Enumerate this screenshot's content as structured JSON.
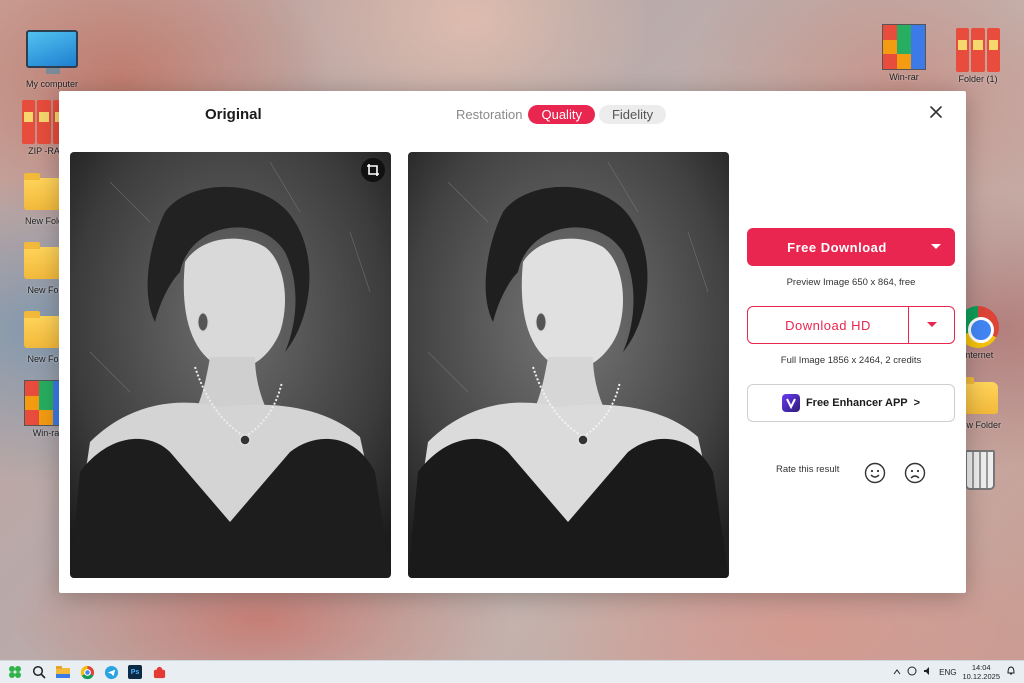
{
  "desktop": {
    "icons": [
      {
        "label": "My computer",
        "icon": "computer-icon"
      },
      {
        "label": "ZIP -RA",
        "icon": "binders-icon"
      },
      {
        "label": "New Fold",
        "icon": "folder-icon"
      },
      {
        "label": "New Fol",
        "icon": "folder-icon"
      },
      {
        "label": "New Fol",
        "icon": "folder-icon"
      },
      {
        "label": "Win-ra",
        "icon": "winrar-icon"
      },
      {
        "label": "Win-rar",
        "icon": "winrar-icon"
      },
      {
        "label": "Folder (1)",
        "icon": "binders-icon"
      },
      {
        "label": "Internet",
        "icon": "chrome-icon"
      },
      {
        "label": "New Folder",
        "icon": "folder-icon"
      },
      {
        "label": "",
        "icon": "recycle-bin-icon"
      }
    ]
  },
  "modal": {
    "title": "Original",
    "tabs": [
      {
        "label": "Restoration",
        "state": "plain"
      },
      {
        "label": "Quality",
        "state": "active"
      },
      {
        "label": "Fidelity",
        "state": "inactive"
      }
    ],
    "free_download": {
      "label": "Free Download",
      "note": "Preview Image 650 x 864, free"
    },
    "download_hd": {
      "label": "Download HD",
      "note": "Full Image 1856 x 2464, 2 credits"
    },
    "enhancer_app": {
      "label": "Free Enhancer APP",
      "arrow": ">"
    },
    "rate": {
      "label": "Rate this result"
    },
    "colors": {
      "accent": "#e8264f"
    }
  },
  "taskbar": {
    "icons": [
      "windows-start-icon",
      "search-icon",
      "file-explorer-icon",
      "chrome-icon",
      "telegram-icon",
      "photoshop-icon",
      "app-icon"
    ],
    "photoshop_text": "Ps",
    "tray": {
      "language": "ENG",
      "time": "14:04",
      "date": "10.12.2025"
    }
  }
}
